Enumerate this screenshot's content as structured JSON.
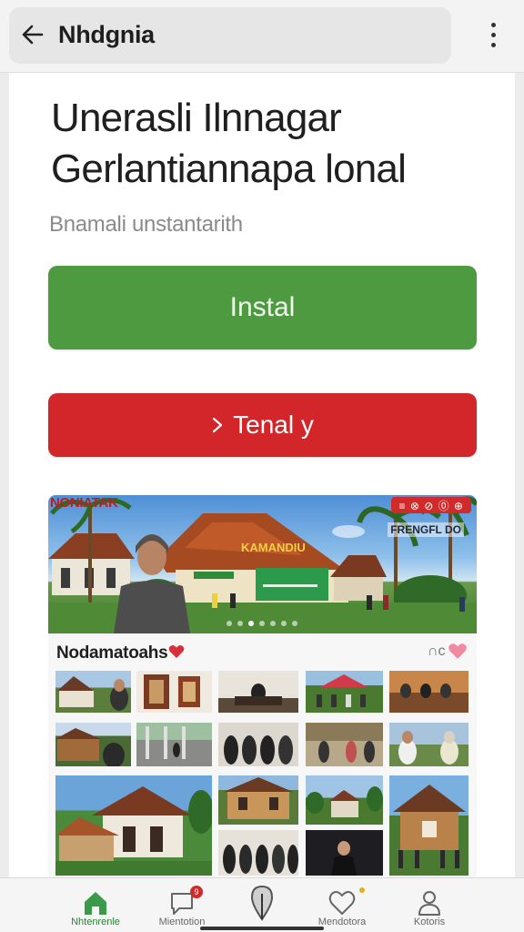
{
  "app_bar": {
    "title": "Nhdgnia",
    "back_icon": "arrow-left-icon",
    "menu_icon": "more-vertical-icon"
  },
  "hero": {
    "headline": "Unerasli Ilnnagar Gerlantiannapa lonal",
    "subtitle": "Bnamali unstantarith"
  },
  "actions": {
    "install_label": "Instal",
    "install_color": "#4e9a40",
    "secondary_label": "Tenal y",
    "secondary_icon": "chevron-right-icon",
    "secondary_color": "#d2262a"
  },
  "banner": {
    "top_title": "NONIATAK",
    "roof_label": "KAMANDIU",
    "badge_text": "≡ ⊗ ⊘ ⓪ ⊕",
    "sign_text": "FRENGFL DO",
    "carousel_total": 7,
    "carousel_active": 2
  },
  "gallery": {
    "title": "Nodamatoahs",
    "title_icon": "heart-icon",
    "action_text": "∩c",
    "action_icon": "heart-icon"
  },
  "bottom_nav": {
    "items": [
      {
        "label": "Nhtenrenle",
        "icon": "home-icon",
        "active": true
      },
      {
        "label": "Mientotion",
        "icon": "chat-icon",
        "badge": "9"
      },
      {
        "label": "",
        "icon": "location-pin-icon"
      },
      {
        "label": "Mendotora",
        "icon": "heart-icon",
        "dot": true
      },
      {
        "label": "Kotoris",
        "icon": "person-icon"
      }
    ]
  },
  "colors": {
    "accent_green": "#4e9a40",
    "accent_red": "#d2262a",
    "nav_active": "#2f7d3a"
  }
}
